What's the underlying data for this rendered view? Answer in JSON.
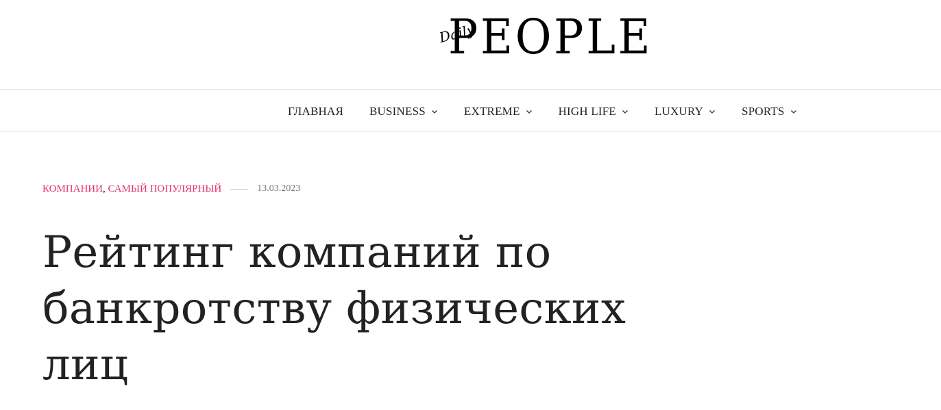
{
  "header": {
    "logo_script": "Daily",
    "logo_word": "PEOPLE"
  },
  "nav": {
    "items": [
      {
        "label": "ГЛАВНАЯ",
        "has_dropdown": false
      },
      {
        "label": "BUSINESS",
        "has_dropdown": true
      },
      {
        "label": "EXTREME",
        "has_dropdown": true
      },
      {
        "label": "HIGH LIFE",
        "has_dropdown": true
      },
      {
        "label": "LUXURY",
        "has_dropdown": true
      },
      {
        "label": "SPORTS",
        "has_dropdown": true
      }
    ],
    "chevron_icon": "chevron-down-icon"
  },
  "post": {
    "categories": [
      {
        "label": "КОМПАНИИ"
      },
      {
        "label": "САМЫЙ ПОПУЛЯРНЫЙ"
      }
    ],
    "category_separator": ",",
    "date": "13.03.2023",
    "title_lines": [
      "Рейтинг компаний по",
      "банкротству физических",
      "лиц"
    ]
  },
  "colors": {
    "accent": "#e0336b",
    "text": "#222222",
    "muted": "#777777",
    "divider": "#e6e6e6"
  }
}
